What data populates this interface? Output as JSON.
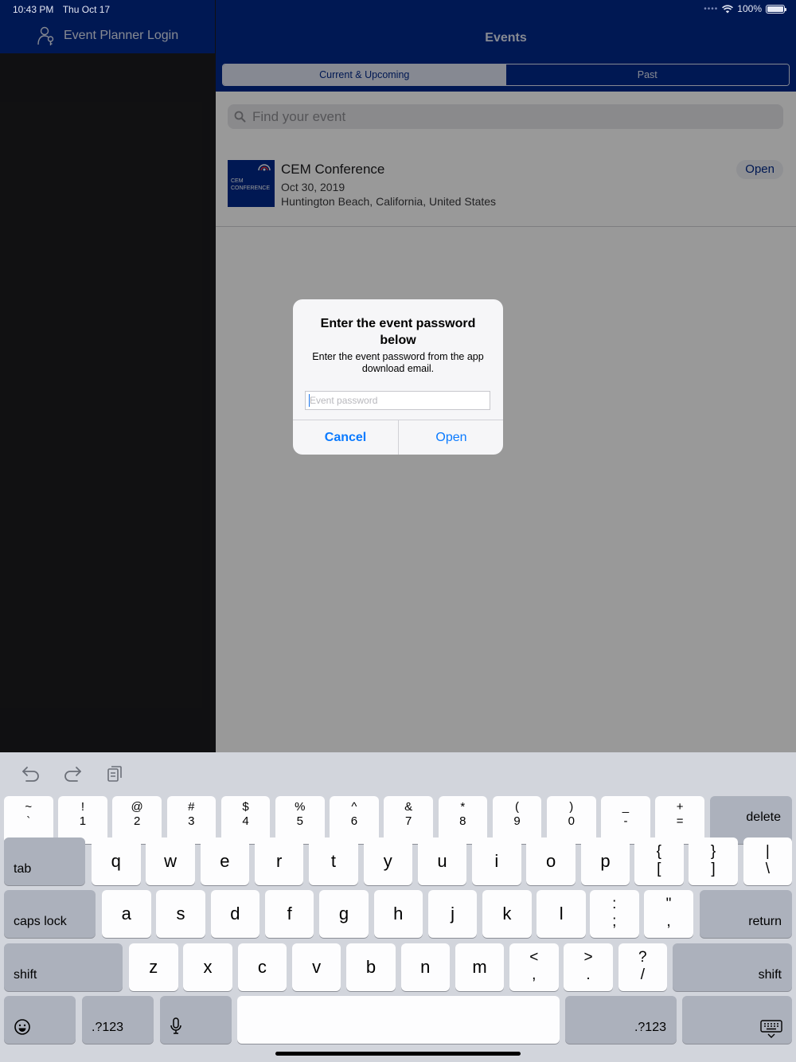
{
  "status_bar": {
    "time": "10:43 PM",
    "date": "Thu Oct 17",
    "battery": "100%",
    "icons": [
      "signal-dots-icon",
      "wifi-icon",
      "battery-icon"
    ]
  },
  "sidebar": {
    "login_label": "Event Planner Login",
    "login_icon": "person-key-icon"
  },
  "main": {
    "title": "Events",
    "tabs": [
      {
        "label": "Current & Upcoming",
        "active": true
      },
      {
        "label": "Past",
        "active": false
      }
    ],
    "search_placeholder": "Find your event",
    "events": [
      {
        "logo_text": "CEM CONFERENCE",
        "name": "CEM Conference",
        "date": "Oct 30, 2019",
        "location": "Huntington Beach, California, United States",
        "action": "Open"
      }
    ]
  },
  "alert": {
    "title": "Enter the event password below",
    "message": "Enter the event password from the app download email.",
    "input_placeholder": "Event password",
    "input_value": "",
    "cancel_label": "Cancel",
    "open_label": "Open"
  },
  "keyboard": {
    "toolbar_icons": [
      "undo-icon",
      "redo-icon",
      "paste-icon"
    ],
    "number_row": [
      {
        "top": "~",
        "bottom": "`"
      },
      {
        "top": "!",
        "bottom": "1"
      },
      {
        "top": "@",
        "bottom": "2"
      },
      {
        "top": "#",
        "bottom": "3"
      },
      {
        "top": "$",
        "bottom": "4"
      },
      {
        "top": "%",
        "bottom": "5"
      },
      {
        "top": "^",
        "bottom": "6"
      },
      {
        "top": "&",
        "bottom": "7"
      },
      {
        "top": "*",
        "bottom": "8"
      },
      {
        "top": "(",
        "bottom": "9"
      },
      {
        "top": ")",
        "bottom": "0"
      },
      {
        "top": "_",
        "bottom": "-"
      },
      {
        "top": "+",
        "bottom": "="
      }
    ],
    "delete_label": "delete",
    "tab_label": "tab",
    "row_qwerty": [
      "q",
      "w",
      "e",
      "r",
      "t",
      "y",
      "u",
      "i",
      "o",
      "p"
    ],
    "row_qwerty_symbols": [
      {
        "top": "{",
        "bottom": "["
      },
      {
        "top": "}",
        "bottom": "]"
      },
      {
        "top": "|",
        "bottom": "\\"
      }
    ],
    "caps_label": "caps lock",
    "row_asdf": [
      "a",
      "s",
      "d",
      "f",
      "g",
      "h",
      "j",
      "k",
      "l"
    ],
    "row_asdf_symbols": [
      {
        "top": ":",
        "bottom": ";"
      },
      {
        "top": "\"",
        "bottom": ","
      }
    ],
    "return_label": "return",
    "shift_label": "shift",
    "row_zxcv": [
      "z",
      "x",
      "c",
      "v",
      "b",
      "n",
      "m"
    ],
    "row_zxcv_symbols": [
      {
        "top": "<",
        "bottom": ","
      },
      {
        "top": ">",
        "bottom": "."
      },
      {
        "top": "?",
        "bottom": "/"
      }
    ],
    "numbers_label": ".?123",
    "bottom_icons": [
      "emoji-icon",
      "microphone-icon",
      "keyboard-dismiss-icon"
    ]
  }
}
